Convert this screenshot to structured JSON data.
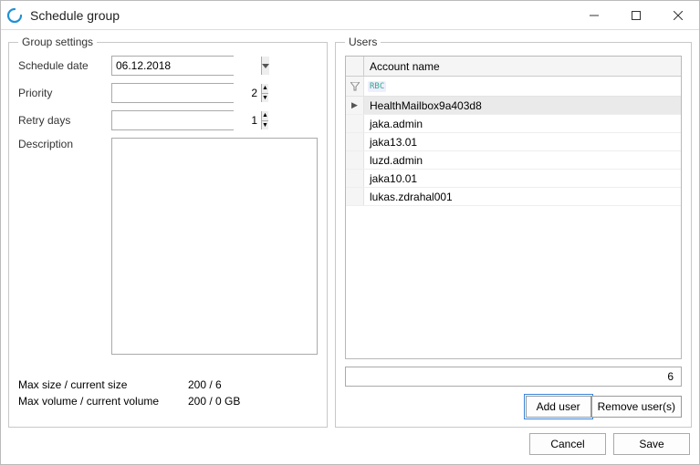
{
  "window": {
    "title": "Schedule group"
  },
  "group_settings": {
    "legend": "Group settings",
    "schedule_date_label": "Schedule date",
    "schedule_date_value": "06.12.2018",
    "priority_label": "Priority",
    "priority_value": "2",
    "retry_days_label": "Retry days",
    "retry_days_value": "1",
    "description_label": "Description",
    "description_value": "",
    "max_size_label": "Max size / current size",
    "max_size_value": "200 / 6",
    "max_volume_label": "Max volume / current volume",
    "max_volume_value": "200 / 0 GB"
  },
  "users": {
    "legend": "Users",
    "column_header": "Account name",
    "filter_glyph": "RBC",
    "rows": [
      {
        "name": "HealthMailbox9a403d8",
        "selected": true
      },
      {
        "name": "jaka.admin",
        "selected": false
      },
      {
        "name": "jaka13.01",
        "selected": false
      },
      {
        "name": "luzd.admin",
        "selected": false
      },
      {
        "name": "jaka10.01",
        "selected": false
      },
      {
        "name": "lukas.zdrahal001",
        "selected": false
      }
    ],
    "count": "6",
    "add_button": "Add user",
    "remove_button": "Remove user(s)"
  },
  "buttons": {
    "cancel": "Cancel",
    "save": "Save"
  }
}
